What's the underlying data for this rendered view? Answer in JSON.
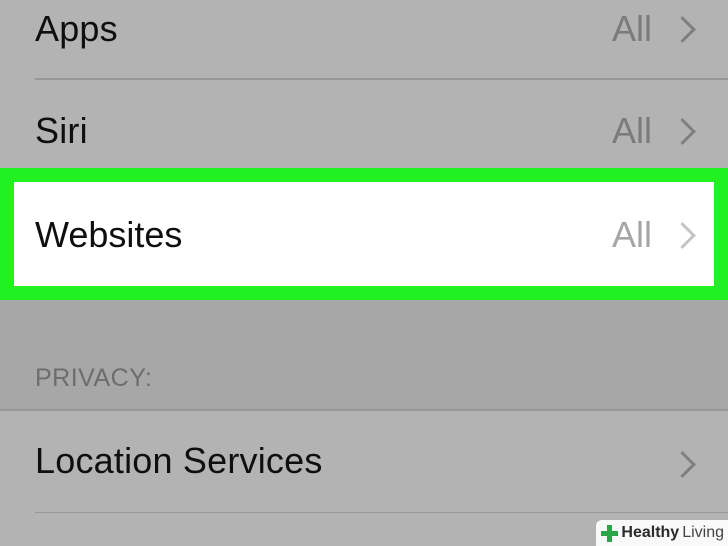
{
  "rows": {
    "apps": {
      "label": "Apps",
      "value": "All"
    },
    "siri": {
      "label": "Siri",
      "value": "All"
    },
    "websites": {
      "label": "Websites",
      "value": "All"
    },
    "location": {
      "label": "Location Services"
    }
  },
  "sections": {
    "privacy_header": "PRIVACY:"
  },
  "watermark": {
    "strong": "Healthy",
    "light": "Living"
  },
  "colors": {
    "highlight": "#21f021",
    "background": "#a7a7a7",
    "cell": "#b3b3b3"
  },
  "icons": {
    "chevron": "chevron-right-icon",
    "watermark": "plus-icon"
  }
}
